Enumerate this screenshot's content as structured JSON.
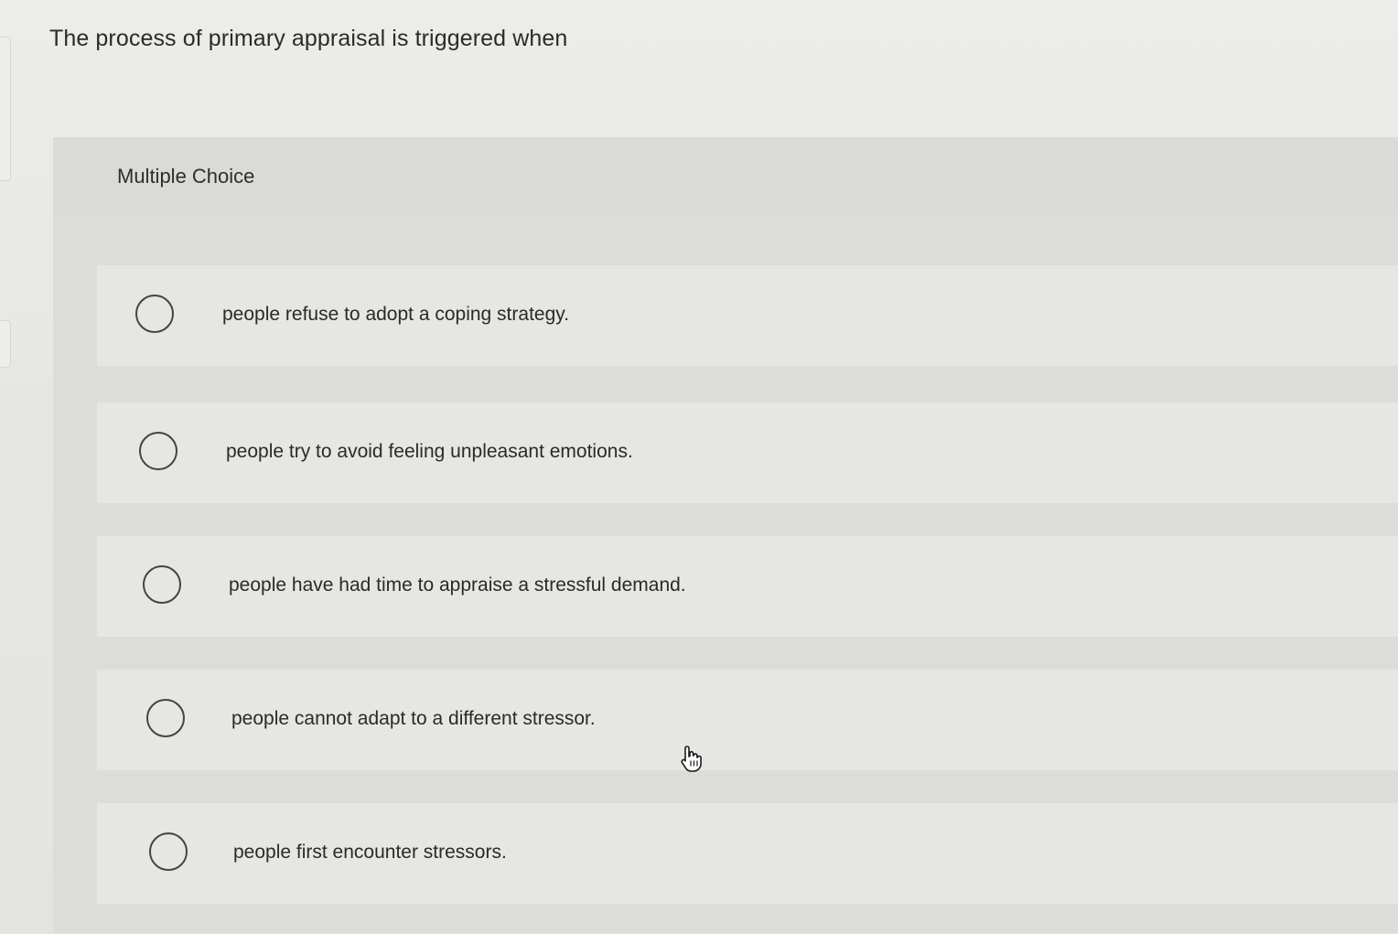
{
  "question": {
    "text": "The process of primary appraisal is triggered when"
  },
  "multiple_choice": {
    "label": "Multiple Choice",
    "options": [
      {
        "label": "people refuse to adopt a coping strategy."
      },
      {
        "label": "people try to avoid feeling unpleasant emotions."
      },
      {
        "label": "people have had time to appraise a stressful demand."
      },
      {
        "label": "people cannot adapt to a different stressor."
      },
      {
        "label": "people first encounter stressors."
      }
    ]
  },
  "icons": {
    "radio": "radio-unselected-icon",
    "cursor": "hand-pointer-cursor-icon"
  }
}
